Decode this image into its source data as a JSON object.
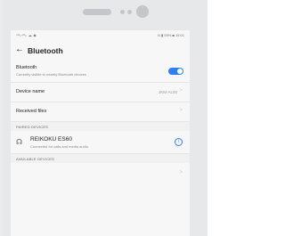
{
  "status_bar": {
    "left": "⁴ᴳᵢₗ⁴ᴳᵢₗ ☁ ◆",
    "right": "N ▮ 59% ■ 15:01"
  },
  "header": {
    "back_icon": "arrow-left-icon",
    "title": "Bluetooth"
  },
  "bluetooth": {
    "label": "Bluetooth",
    "sublabel": "Currently visible to nearby Bluetooth devices",
    "enabled": true
  },
  "device_name": {
    "label": "Device name",
    "value": "JKM-AL00"
  },
  "received_files": {
    "label": "Received files"
  },
  "paired_section": {
    "title": "PAIRED DEVICES"
  },
  "paired_devices": [
    {
      "name": "REIKOKU ES60",
      "status": "Connected for calls and media audio",
      "icon": "headphones-icon"
    }
  ],
  "available_section": {
    "title": "AVAILABLE DEVICES"
  },
  "colors": {
    "accent": "#2e7ff0",
    "toggle_on": "#2e7ff0"
  }
}
